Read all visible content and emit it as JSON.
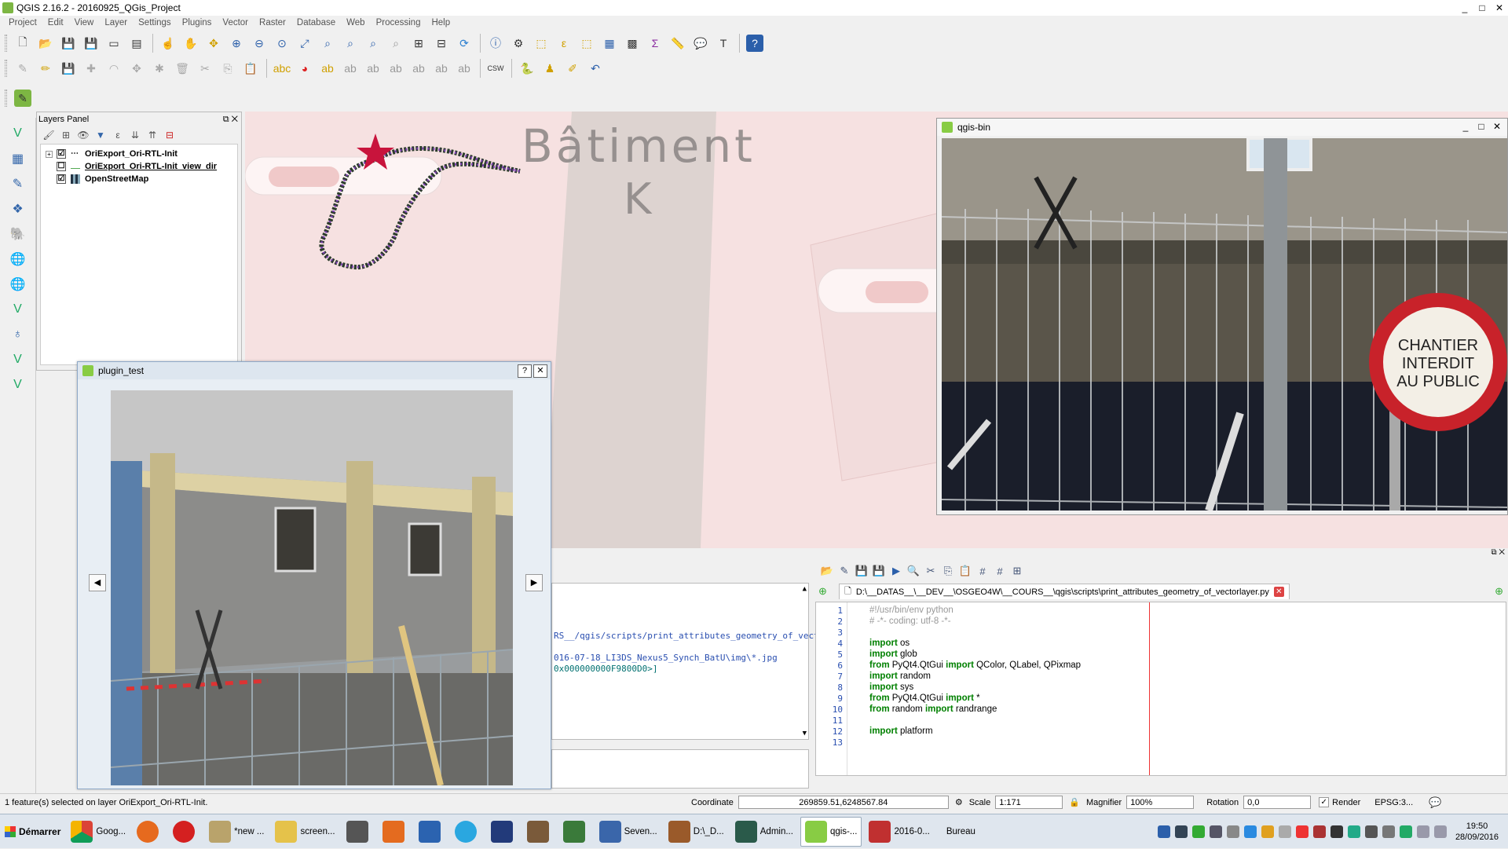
{
  "window": {
    "title": "QGIS 2.16.2 - 20160925_QGis_Project",
    "controls": [
      "_",
      "□",
      "✕"
    ]
  },
  "menu": [
    "Project",
    "Edit",
    "View",
    "Layer",
    "Settings",
    "Plugins",
    "Vector",
    "Raster",
    "Database",
    "Web",
    "Processing",
    "Help"
  ],
  "layers_panel": {
    "title": "Layers Panel",
    "layers": [
      {
        "name": "OriExport_Ori-RTL-Init",
        "checked": "☑",
        "expand": "+"
      },
      {
        "name": "OriExport_Ori-RTL-Init_view_dir",
        "checked": "☐",
        "expand": ""
      },
      {
        "name": "OpenStreetMap",
        "checked": "☑",
        "expand": ""
      }
    ]
  },
  "map": {
    "building_label": "Bâtiment",
    "building_letter": "K"
  },
  "plugin_dialog": {
    "title": "plugin_test",
    "help": "?",
    "close": "✕",
    "prev": "◀",
    "next": "▶"
  },
  "qgis_bin": {
    "title": "qgis-bin",
    "sign_line1": "CHANTIER",
    "sign_line2": "INTERDIT",
    "sign_line3": "AU PUBLIC"
  },
  "console": {
    "output_lines": [
      "RS__/qgis/scripts/print_attributes_geometry_of_vect",
      "016-07-18_LI3DS_Nexus5_Synch_BatU\\img\\*.jpg",
      "0x000000000F9800D0>]"
    ],
    "tab_file": "D:\\__DATAS__\\__DEV__\\OSGEO4W\\__COURS__\\qgis\\scripts\\print_attributes_geometry_of_vectorlayer.py",
    "code_lines": [
      {
        "n": "1",
        "t": "#!/usr/bin/env python"
      },
      {
        "n": "2",
        "t": "# -*- coding: utf-8 -*-"
      },
      {
        "n": "3",
        "t": ""
      },
      {
        "n": "4",
        "t": "import os"
      },
      {
        "n": "5",
        "t": "import glob"
      },
      {
        "n": "6",
        "t": "from PyQt4.QtGui import QColor, QLabel, QPixmap"
      },
      {
        "n": "7",
        "t": "import random"
      },
      {
        "n": "8",
        "t": "import sys"
      },
      {
        "n": "9",
        "t": "from PyQt4.QtGui import *"
      },
      {
        "n": "10",
        "t": "from random import randrange"
      },
      {
        "n": "11",
        "t": ""
      },
      {
        "n": "12",
        "t": "import platform"
      },
      {
        "n": "13",
        "t": ""
      }
    ]
  },
  "status": {
    "message": "1 feature(s) selected on layer OriExport_Ori-RTL-Init.",
    "coordinate_label": "Coordinate",
    "coordinate": "269859.51,6248567.84",
    "scale_label": "Scale",
    "scale": "1:171",
    "magnifier_label": "Magnifier",
    "magnifier": "100%",
    "rotation_label": "Rotation",
    "rotation": "0,0",
    "render_label": "Render",
    "crs": "EPSG:3..."
  },
  "taskbar": {
    "start": "Démarrer",
    "tasks": [
      {
        "label": "Goog...",
        "color": "#e8c13a"
      },
      {
        "label": "",
        "color": "#e66a1e"
      },
      {
        "label": "",
        "color": "#d42020"
      },
      {
        "label": "*new ...",
        "color": "#b9a36b"
      },
      {
        "label": "screen...",
        "color": "#e5c24a"
      },
      {
        "label": "",
        "color": "#555"
      },
      {
        "label": "",
        "color": "#e46b1f"
      },
      {
        "label": "",
        "color": "#2b63b0"
      },
      {
        "label": "",
        "color": "#2aa7e0"
      },
      {
        "label": "",
        "color": "#223a7a"
      },
      {
        "label": "",
        "color": "#7a5a3a"
      },
      {
        "label": "",
        "color": "#3a7a3a"
      },
      {
        "label": "Seven...",
        "color": "#3a66aa"
      },
      {
        "label": "D:\\_D...",
        "color": "#9a5a2a"
      },
      {
        "label": "Admin...",
        "color": "#2a5a4a"
      },
      {
        "label": "qgis-...",
        "color": "#8c4"
      },
      {
        "label": "2016-0...",
        "color": "#c03030"
      }
    ],
    "bureau": "Bureau",
    "time": "19:50",
    "date": "28/09/2016"
  }
}
